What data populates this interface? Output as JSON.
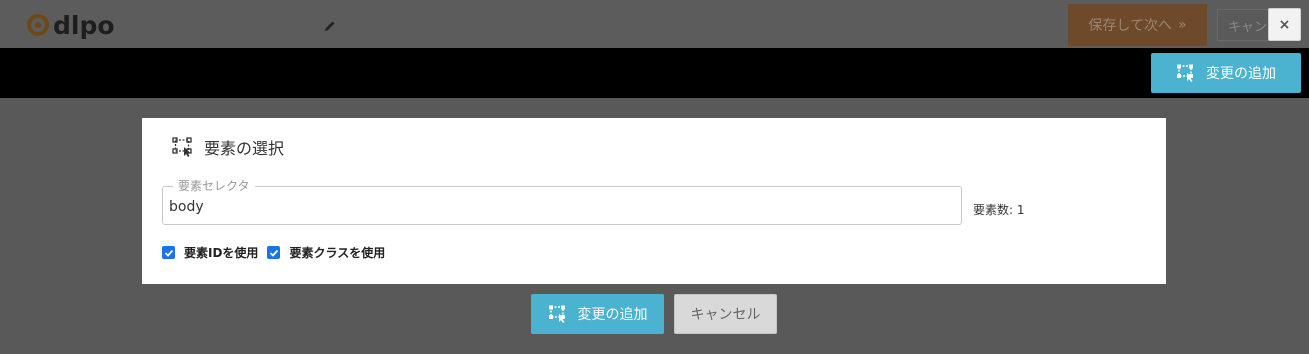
{
  "header": {
    "logo_text": "dlpo",
    "save_next_label": "保存して次へ",
    "cancel_label": "キャンセル",
    "close_label": "×"
  },
  "toolbar": {
    "add_change_label": "変更の追加"
  },
  "panel": {
    "title": "要素の選択",
    "selector_legend": "要素セレクタ",
    "selector_value": "body",
    "element_count": "要素数: 1",
    "checkboxes": [
      {
        "label": "要素IDを使用",
        "checked": true
      },
      {
        "label": "要素クラスを使用",
        "checked": true
      }
    ]
  },
  "footer": {
    "add_change_label": "変更の追加",
    "cancel_label": "キャンセル"
  },
  "colors": {
    "accent": "#4bb3cf",
    "checkbox": "#1a73e8",
    "overlay": "#595959"
  },
  "icons": [
    "pencil-icon",
    "chevron-double-right-icon",
    "selector-icon",
    "check-icon"
  ]
}
